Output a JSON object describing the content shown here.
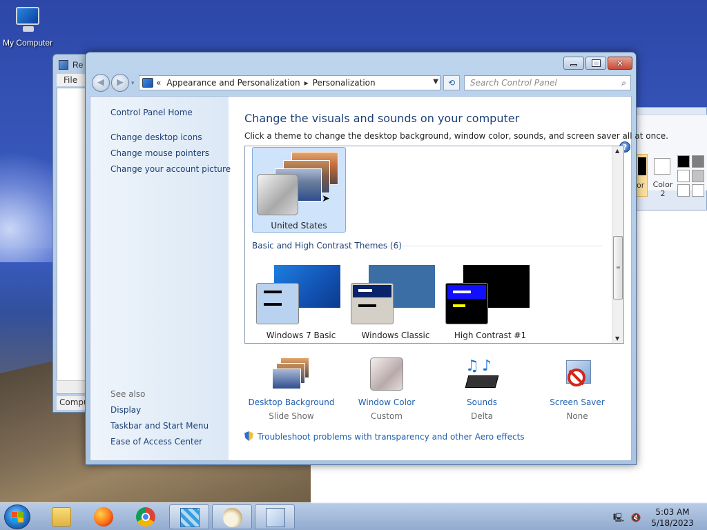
{
  "desktop": {
    "icon_label": "My Computer"
  },
  "background_windows": {
    "regedit": {
      "title": "Re",
      "menu": "File",
      "status": "Compu"
    },
    "paint": {
      "color1_label": "or",
      "color2_label": "Color 2"
    }
  },
  "window": {
    "address": {
      "recent": "«",
      "crumb1": "Appearance and Personalization",
      "crumb2": "Personalization"
    },
    "search_placeholder": "Search Control Panel",
    "sidebar": {
      "home": "Control Panel Home",
      "links": [
        "Change desktop icons",
        "Change mouse pointers",
        "Change your account picture"
      ],
      "see_also_label": "See also",
      "see_also": [
        "Display",
        "Taskbar and Start Menu",
        "Ease of Access Center"
      ]
    },
    "heading": "Change the visuals and sounds on your computer",
    "subheading": "Click a theme to change the desktop background, window color, sounds, and screen saver all at once.",
    "selected_theme": "United States",
    "group_header": "Basic and High Contrast Themes (6)",
    "themes": [
      "Windows 7 Basic",
      "Windows Classic",
      "High Contrast #1"
    ],
    "settings": [
      {
        "link": "Desktop Background",
        "value": "Slide Show"
      },
      {
        "link": "Window Color",
        "value": "Custom"
      },
      {
        "link": "Sounds",
        "value": "Delta"
      },
      {
        "link": "Screen Saver",
        "value": "None"
      }
    ],
    "troubleshoot": "Troubleshoot problems with transparency and other Aero effects"
  },
  "taskbar": {
    "time": "5:03 AM",
    "date": "5/18/2023"
  }
}
